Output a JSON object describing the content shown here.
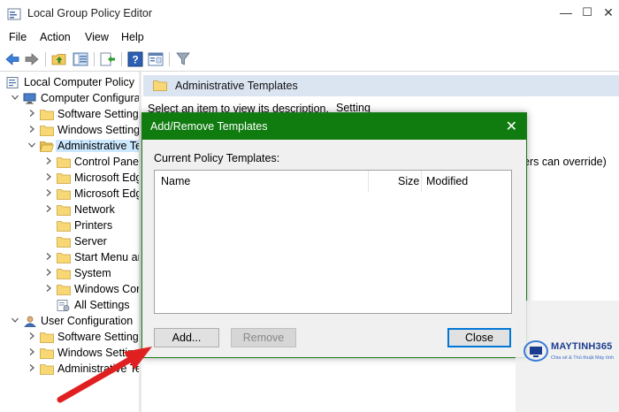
{
  "window": {
    "title": "Local Group Policy Editor",
    "controls": {
      "minimize": "—",
      "maximize": "☐",
      "close": "✕"
    }
  },
  "menu": [
    "File",
    "Action",
    "View",
    "Help"
  ],
  "toolbar_icons": [
    "back-arrow-icon",
    "forward-arrow-icon",
    "up-folder-icon",
    "show-hide-tree-icon",
    "export-list-icon",
    "help-icon",
    "properties-icon",
    "filter-icon"
  ],
  "tree": [
    {
      "label": "Local Computer Policy",
      "icon": "policy-icon",
      "expander": ""
    },
    {
      "label": "Computer Configura",
      "icon": "computer-icon",
      "expander": "v"
    },
    {
      "label": "Software Settings",
      "icon": "folder-icon",
      "expander": ">"
    },
    {
      "label": "Windows Settings",
      "icon": "folder-icon",
      "expander": ">"
    },
    {
      "label": "Administrative Te",
      "icon": "folder-open-icon",
      "expander": "v",
      "selected": true
    },
    {
      "label": "Control Panel",
      "icon": "folder-icon",
      "expander": ">"
    },
    {
      "label": "Microsoft Edg",
      "icon": "folder-icon",
      "expander": ">"
    },
    {
      "label": "Microsoft Edg",
      "icon": "folder-icon",
      "expander": ">"
    },
    {
      "label": "Network",
      "icon": "folder-icon",
      "expander": ">"
    },
    {
      "label": "Printers",
      "icon": "folder-icon",
      "expander": ""
    },
    {
      "label": "Server",
      "icon": "folder-icon",
      "expander": ""
    },
    {
      "label": "Start Menu ar",
      "icon": "folder-icon",
      "expander": ">"
    },
    {
      "label": "System",
      "icon": "folder-icon",
      "expander": ">"
    },
    {
      "label": "Windows Cor",
      "icon": "folder-icon",
      "expander": ">"
    },
    {
      "label": "All Settings",
      "icon": "all-settings-icon",
      "expander": ""
    },
    {
      "label": "User Configuration",
      "icon": "user-icon",
      "expander": "v"
    },
    {
      "label": "Software Settings",
      "icon": "folder-icon",
      "expander": ">"
    },
    {
      "label": "Windows Setting",
      "icon": "folder-icon",
      "expander": ">"
    },
    {
      "label": "Administrative Te",
      "icon": "folder-icon",
      "expander": ">"
    }
  ],
  "right_pane": {
    "header": "Administrative Templates",
    "description": "Select an item to view its description.",
    "column_setting": "Setting",
    "partial_text": "ers can override)"
  },
  "dialog": {
    "title": "Add/Remove Templates",
    "close": "✕",
    "list_label": "Current Policy Templates:",
    "columns": [
      "Name",
      "Size",
      "Modified"
    ],
    "buttons": {
      "add": "Add...",
      "remove": "Remove",
      "close": "Close"
    }
  },
  "watermark": {
    "brand": "MAYTINH365",
    "tagline": "Chia sẻ & Thủ thuật Máy tính"
  },
  "colors": {
    "dialog_title": "#107c10",
    "selection": "#cce8ff",
    "header_band": "#dbe4f1",
    "arrow": "#e02020"
  }
}
